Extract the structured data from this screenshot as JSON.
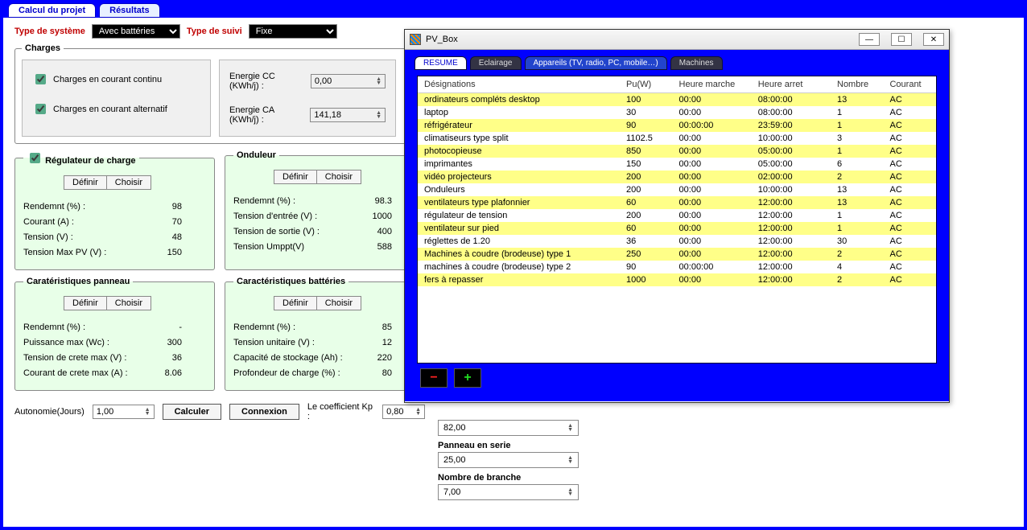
{
  "topTabs": [
    "Calcul du projet",
    "Résultats"
  ],
  "typeSysteme": {
    "label": "Type de système",
    "value": "Avec battéries"
  },
  "typeSuivi": {
    "label": "Type de suivi",
    "value": "Fixe"
  },
  "charges": {
    "legend": "Charges",
    "cc": "Charges en courant continu",
    "ca": "Charges en courant alternatif",
    "energieCC": {
      "label": "Energie CC (KWh/j) :",
      "value": "0,00"
    },
    "energieCA": {
      "label": "Energie CA (KWh/j) :",
      "value": "141,18"
    }
  },
  "regulateur": {
    "legend": "Régulateur de charge",
    "definir": "Définir",
    "choisir": "Choisir",
    "rows": [
      {
        "k": "Rendemnt (%) :",
        "v": "98"
      },
      {
        "k": "Courant (A) :",
        "v": "70"
      },
      {
        "k": "Tension (V) :",
        "v": "48"
      },
      {
        "k": "Tension Max PV (V) :",
        "v": "150"
      }
    ]
  },
  "onduleur": {
    "legend": "Onduleur",
    "definir": "Définir",
    "choisir": "Choisir",
    "rows": [
      {
        "k": "Rendemnt (%) :",
        "v": "98.3"
      },
      {
        "k": "Tension d'entrée (V) :",
        "v": "1000"
      },
      {
        "k": "Tension de sortie (V) :",
        "v": "400"
      },
      {
        "k": "Tension Umppt(V)",
        "v": "588"
      }
    ]
  },
  "panneau": {
    "legend": "Caratéristiques panneau",
    "definir": "Définir",
    "choisir": "Choisir",
    "rows": [
      {
        "k": "Rendemnt (%) :",
        "v": "-"
      },
      {
        "k": "Puissance max (Wc) :",
        "v": "300"
      },
      {
        "k": "Tension de crete max (V) :",
        "v": "36"
      },
      {
        "k": "Courant de crete max (A) :",
        "v": "8.06"
      }
    ]
  },
  "batteries": {
    "legend": "Caractéristiques battéries",
    "definir": "Définir",
    "choisir": "Choisir",
    "rows": [
      {
        "k": "Rendemnt (%) :",
        "v": "85"
      },
      {
        "k": "Tension unitaire (V) :",
        "v": "12"
      },
      {
        "k": "Capacité de stockage (Ah) :",
        "v": "220"
      },
      {
        "k": "Profondeur de charge (%) :",
        "v": "80"
      }
    ]
  },
  "bottom": {
    "autonomie": "Autonomie(Jours)",
    "autonomieVal": "1,00",
    "calculer": "Calculer",
    "connexion": "Connexion",
    "coeff": "Le coefficient Kp :",
    "coeffVal": "0,80"
  },
  "rightCalc": {
    "g1": {
      "val": "82,00"
    },
    "g2": {
      "label": "Panneau en serie",
      "val": "25,00"
    },
    "g3": {
      "label": "Nombre de branche",
      "val": "7,00"
    }
  },
  "dialog": {
    "title": "PV_Box",
    "tabs": [
      "RESUME",
      "Eclairage",
      "Appareils (TV, radio, PC, mobile…)",
      "Machines"
    ],
    "headers": [
      "Désignations",
      "Pu(W)",
      "Heure marche",
      "Heure arret",
      "Nombre",
      "Courant"
    ],
    "rows": [
      [
        "ordinateurs compléts desktop",
        "100",
        "00:00",
        "08:00:00",
        "13",
        "AC"
      ],
      [
        "laptop",
        "30",
        "00:00",
        "08:00:00",
        "1",
        "AC"
      ],
      [
        "réfrigérateur",
        "90",
        "00:00:00",
        "23:59:00",
        "1",
        "AC"
      ],
      [
        "climatiseurs type split",
        "1102.5",
        "00:00",
        "10:00:00",
        "3",
        "AC"
      ],
      [
        "photocopieuse",
        "850",
        "00:00",
        "05:00:00",
        "1",
        "AC"
      ],
      [
        "imprimantes",
        "150",
        "00:00",
        "05:00:00",
        "6",
        "AC"
      ],
      [
        "vidéo projecteurs",
        "200",
        "00:00",
        "02:00:00",
        "2",
        "AC"
      ],
      [
        "Onduleurs",
        "200",
        "00:00",
        "10:00:00",
        "13",
        "AC"
      ],
      [
        "ventilateurs type plafonnier",
        "60",
        "00:00",
        "12:00:00",
        "13",
        "AC"
      ],
      [
        "régulateur de tension",
        "200",
        "00:00",
        "12:00:00",
        "1",
        "AC"
      ],
      [
        "ventilateur sur pied",
        "60",
        "00:00",
        "12:00:00",
        "1",
        "AC"
      ],
      [
        "réglettes de 1.20",
        "36",
        "00:00",
        "12:00:00",
        "30",
        "AC"
      ],
      [
        "Machines à coudre (brodeuse) type 1",
        "250",
        "00:00",
        "12:00:00",
        "2",
        "AC"
      ],
      [
        "machines à coudre (brodeuse) type 2",
        "90",
        "00:00:00",
        "12:00:00",
        "4",
        "AC"
      ],
      [
        "fers à repasser",
        "1000",
        "00:00",
        "12:00:00",
        "2",
        "AC"
      ]
    ]
  }
}
